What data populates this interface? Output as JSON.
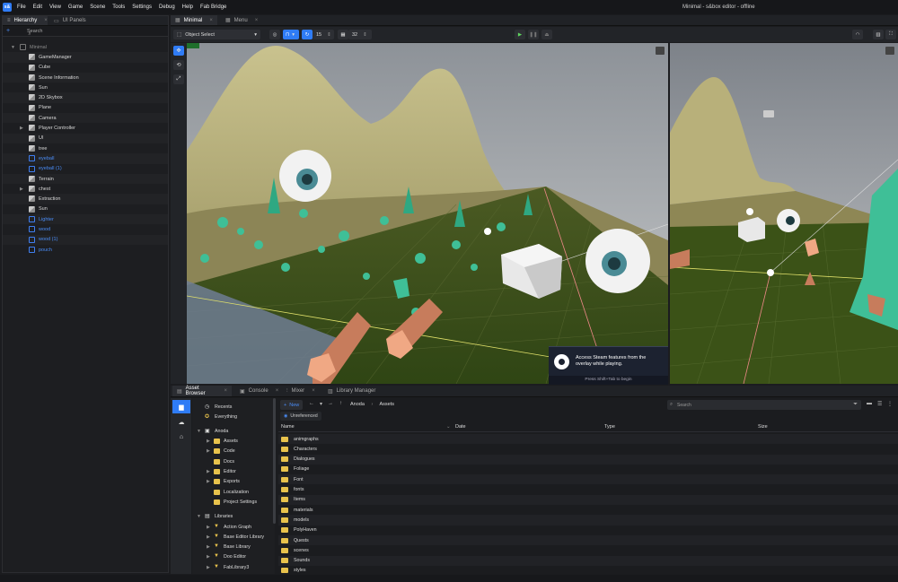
{
  "window": {
    "title": "Minimal - s&box editor - offline",
    "logo_text": "s&"
  },
  "menu": [
    "File",
    "Edit",
    "View",
    "Game",
    "Scene",
    "Tools",
    "Settings",
    "Debug",
    "Help",
    "Fab Bridge"
  ],
  "hierarchy": {
    "tabs": [
      {
        "label": "Hierarchy",
        "active": true
      },
      {
        "label": "UI Panels",
        "active": false
      }
    ],
    "search_placeholder": "Search",
    "root": "Minimal",
    "items": [
      {
        "label": "GameManager",
        "icon": "gameobject-icon",
        "blue": false,
        "expandable": false
      },
      {
        "label": "Cube",
        "icon": "gameobject-icon",
        "blue": false,
        "expandable": false
      },
      {
        "label": "Scene Information",
        "icon": "gameobject-icon",
        "blue": false,
        "expandable": false
      },
      {
        "label": "Sun",
        "icon": "gameobject-icon",
        "blue": false,
        "expandable": false
      },
      {
        "label": "2D Skybox",
        "icon": "gameobject-icon",
        "blue": false,
        "expandable": false
      },
      {
        "label": "Plane",
        "icon": "gameobject-icon",
        "blue": false,
        "expandable": false
      },
      {
        "label": "Camera",
        "icon": "gameobject-icon",
        "blue": false,
        "expandable": false
      },
      {
        "label": "Player Controller",
        "icon": "gameobject-icon",
        "blue": false,
        "expandable": true
      },
      {
        "label": "UI",
        "icon": "gameobject-icon",
        "blue": false,
        "expandable": false
      },
      {
        "label": "tree",
        "icon": "gameobject-icon",
        "blue": false,
        "expandable": false
      },
      {
        "label": "eyeball",
        "icon": "prefab-icon",
        "blue": true,
        "expandable": false
      },
      {
        "label": "eyeball (1)",
        "icon": "prefab-icon",
        "blue": true,
        "expandable": false
      },
      {
        "label": "Terrain",
        "icon": "gameobject-icon",
        "blue": false,
        "expandable": false
      },
      {
        "label": "chest",
        "icon": "gameobject-icon",
        "blue": false,
        "expandable": true
      },
      {
        "label": "Extraction",
        "icon": "gameobject-icon",
        "blue": false,
        "expandable": false
      },
      {
        "label": "Sun",
        "icon": "gameobject-icon",
        "blue": false,
        "expandable": false
      },
      {
        "label": "Lighter",
        "icon": "prefab-icon",
        "blue": true,
        "expandable": false
      },
      {
        "label": "wood",
        "icon": "prefab-icon",
        "blue": true,
        "expandable": false
      },
      {
        "label": "wood (1)",
        "icon": "prefab-icon",
        "blue": true,
        "expandable": false
      },
      {
        "label": "pouch",
        "icon": "prefab-icon",
        "blue": true,
        "expandable": false
      }
    ]
  },
  "viewport": {
    "tabs": [
      {
        "label": "Minimal",
        "active": true
      },
      {
        "label": "Menu",
        "active": false
      }
    ],
    "mode": "Object Select",
    "snap_angle": "15",
    "grid_size": "32",
    "steam_overlay": {
      "message": "Access Steam features from the overlay while playing.",
      "hint": "Press Shift+Tab to begin"
    }
  },
  "bottom": {
    "tabs": [
      {
        "label": "Asset Browser",
        "active": true
      },
      {
        "label": "Console",
        "active": false
      },
      {
        "label": "Mixer",
        "active": false
      },
      {
        "label": "Library Manager",
        "active": false
      }
    ],
    "tree": {
      "quick": [
        "Recents",
        "Everything"
      ],
      "project": "Anoda",
      "project_items": [
        {
          "label": "Assets",
          "expandable": true
        },
        {
          "label": "Code",
          "expandable": true
        },
        {
          "label": "Docs",
          "expandable": false
        },
        {
          "label": "Editor",
          "expandable": true
        },
        {
          "label": "Exports",
          "expandable": true
        },
        {
          "label": "Localization",
          "expandable": false
        },
        {
          "label": "Project Settings",
          "expandable": false
        }
      ],
      "libraries": "Libraries",
      "library_items": [
        "Action Graph",
        "Base Editor Library",
        "Base Library",
        "Doo Editor",
        "FabLibrary3"
      ]
    },
    "new_label": "New",
    "breadcrumb": [
      "Anoda",
      "Assets"
    ],
    "search_placeholder": "Search",
    "filter_label": "Unreferenced",
    "columns": [
      "Name",
      "Date",
      "Type",
      "Size"
    ],
    "files": [
      "animgraphs",
      "Characters",
      "Dialogues",
      "Foliage",
      "Font",
      "fonts",
      "Items",
      "materials",
      "models",
      "PolyHaven",
      "Quests",
      "scenes",
      "Sounds",
      "styles"
    ]
  }
}
